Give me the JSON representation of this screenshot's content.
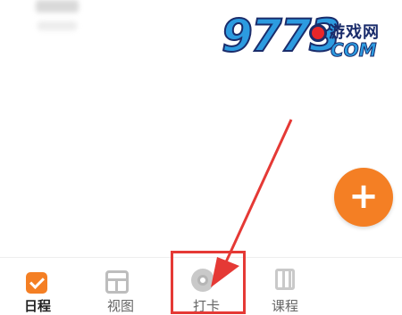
{
  "tabbar": {
    "tabs": [
      {
        "label": "日程",
        "icon": "schedule-icon",
        "active": true
      },
      {
        "label": "视图",
        "icon": "view-icon",
        "active": false
      },
      {
        "label": "打卡",
        "icon": "check-in-icon",
        "active": false
      },
      {
        "label": "课程",
        "icon": "course-icon",
        "active": false
      }
    ]
  },
  "fab": {
    "label": "+",
    "icon": "plus-icon"
  },
  "watermark": {
    "number": "9773",
    "site_cn": "游戏网",
    "site_com": "COM"
  },
  "colors": {
    "accent": "#f47f24",
    "active_label": "#222222",
    "inactive_label": "#666666",
    "annotation": "#e53935"
  }
}
